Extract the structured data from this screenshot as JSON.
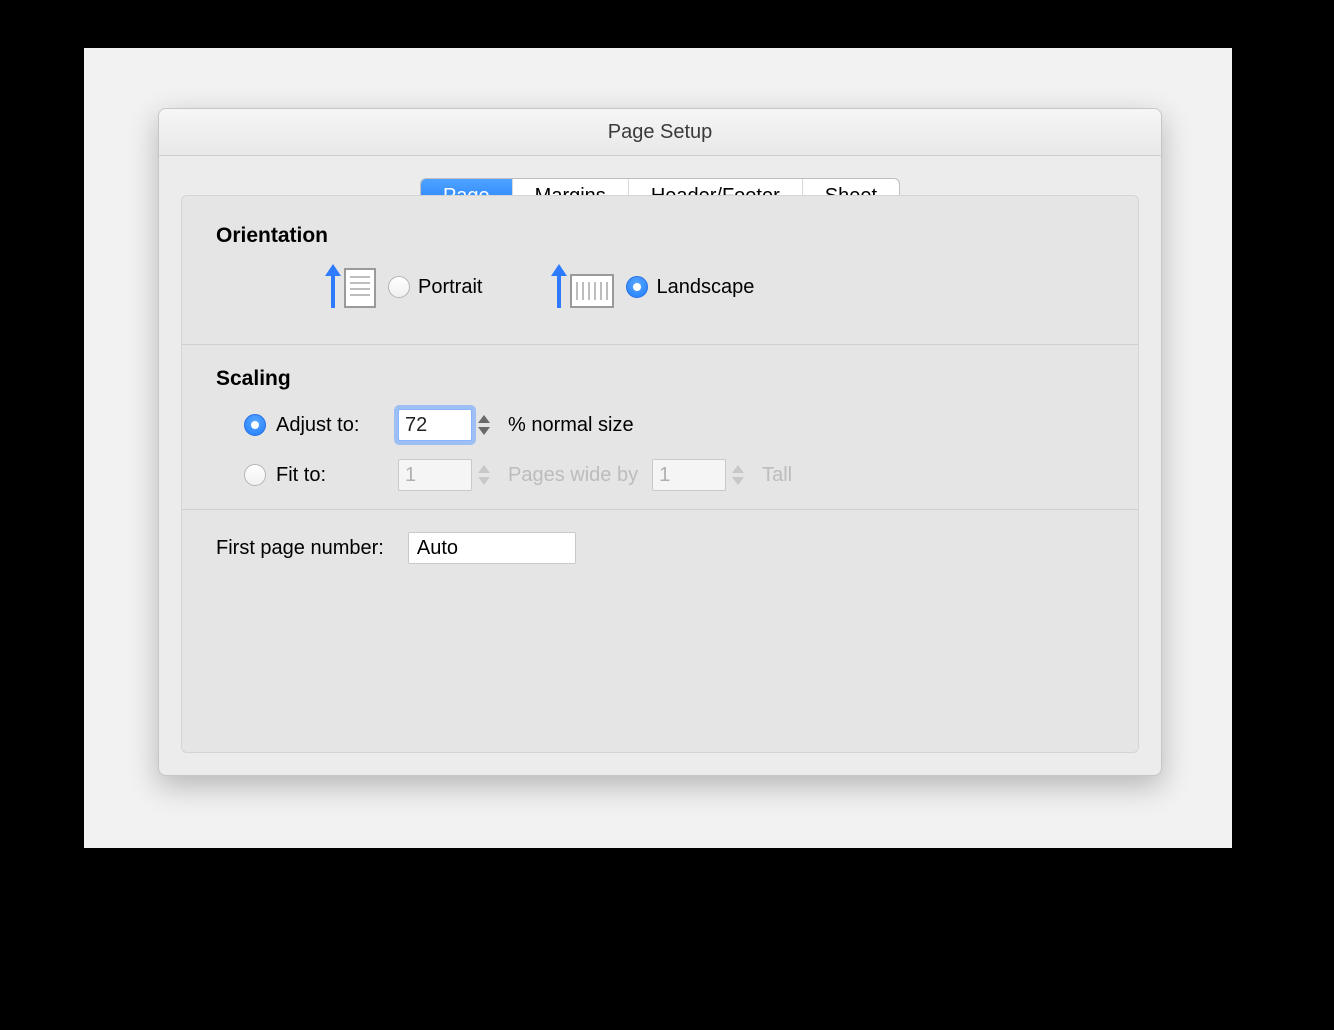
{
  "window": {
    "title": "Page Setup"
  },
  "tabs": [
    {
      "label": "Page",
      "active": true
    },
    {
      "label": "Margins",
      "active": false
    },
    {
      "label": "Header/Footer",
      "active": false
    },
    {
      "label": "Sheet",
      "active": false
    }
  ],
  "orientation": {
    "title": "Orientation",
    "portrait_label": "Portrait",
    "landscape_label": "Landscape",
    "selected": "landscape"
  },
  "scaling": {
    "title": "Scaling",
    "adjust_label": "Adjust to:",
    "adjust_value": "72",
    "adjust_suffix": "% normal size",
    "fit_label": "Fit to:",
    "fit_wide_value": "1",
    "fit_mid_label": "Pages wide by",
    "fit_tall_value": "1",
    "fit_tall_label": "Tall",
    "selected": "adjust"
  },
  "first_page": {
    "label": "First page number:",
    "value": "Auto"
  }
}
